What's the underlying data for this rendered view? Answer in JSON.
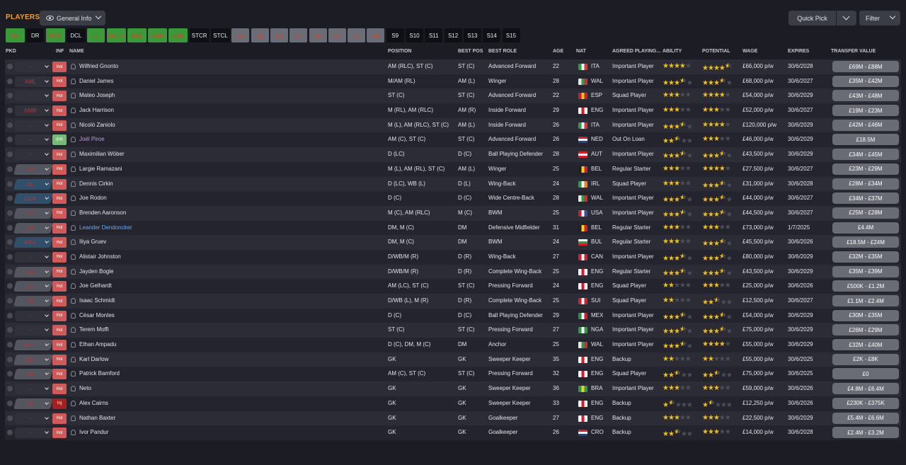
{
  "header": {
    "title": "PLAYERS",
    "view": "General Info",
    "quick_pick": "Quick Pick",
    "filter": "Filter"
  },
  "positions": [
    {
      "label": "GK",
      "state": "green"
    },
    {
      "label": "DR",
      "state": "off"
    },
    {
      "label": "DCR",
      "state": "green"
    },
    {
      "label": "DCL",
      "state": "off"
    },
    {
      "label": "DL",
      "state": "green"
    },
    {
      "label": "DMCR",
      "state": "green"
    },
    {
      "label": "MCL",
      "state": "green"
    },
    {
      "label": "AMR",
      "state": "green"
    },
    {
      "label": "AML",
      "state": "green"
    },
    {
      "label": "STCR",
      "state": "off"
    },
    {
      "label": "STCL",
      "state": "off"
    },
    {
      "label": "S1",
      "state": "gray"
    },
    {
      "label": "S2",
      "state": "gray"
    },
    {
      "label": "S3",
      "state": "gray"
    },
    {
      "label": "S4",
      "state": "gray"
    },
    {
      "label": "S5",
      "state": "gray"
    },
    {
      "label": "S6",
      "state": "gray"
    },
    {
      "label": "S7",
      "state": "gray"
    },
    {
      "label": "S8",
      "state": "gray"
    },
    {
      "label": "S9",
      "state": "off"
    },
    {
      "label": "S10",
      "state": "off"
    },
    {
      "label": "S11",
      "state": "off"
    },
    {
      "label": "S12",
      "state": "off"
    },
    {
      "label": "S13",
      "state": "off"
    },
    {
      "label": "S14",
      "state": "off"
    },
    {
      "label": "S15",
      "state": "off"
    }
  ],
  "columns": {
    "pkd": "PKD",
    "inf": "INF",
    "name": "NAME",
    "position": "POSITION",
    "best_pos": "BEST POS",
    "best_role": "BEST ROLE",
    "age": "AGE",
    "nat": "NAT",
    "agreed": "AGREED PLAYING...",
    "ability": "ABILITY",
    "potential": "POTENTIAL",
    "wage": "WAGE",
    "expires": "EXPIRES",
    "transfer_value": "TRANSFER VALUE"
  },
  "colors": {
    "ITA": [
      "#2e9a48",
      "#f2f2f2",
      "#d23a3a"
    ],
    "WAL": [
      "#e8e8e8",
      "#2e9a48",
      "#c83030"
    ],
    "ESP": [
      "#c8202a",
      "#f2c020",
      "#c8202a"
    ],
    "ENG": [
      "#f4f4f4",
      "#d02030",
      "#f4f4f4"
    ],
    "NED": [
      "#c02030",
      "#f4f4f4",
      "#25408f"
    ],
    "AUT": [
      "#d02030",
      "#f4f4f4",
      "#d02030"
    ],
    "BEL": [
      "#202020",
      "#f2d020",
      "#d02030"
    ],
    "IRL": [
      "#2e9a48",
      "#f4f4f4",
      "#f08030"
    ],
    "USA": [
      "#c02030",
      "#f4f4f4",
      "#3c4a9a"
    ],
    "BUL": [
      "#f4f4f4",
      "#2e9a48",
      "#d02030"
    ],
    "CAN": [
      "#d02030",
      "#f4f4f4",
      "#d02030"
    ],
    "SUI": [
      "#d02030",
      "#f4f4f4",
      "#d02030"
    ],
    "MEX": [
      "#2e8a48",
      "#f4f4f4",
      "#c02030"
    ],
    "NGA": [
      "#2e9a48",
      "#f4f4f4",
      "#2e9a48"
    ],
    "BRA": [
      "#2e9a48",
      "#f2d020",
      "#2e9a48"
    ],
    "CRO": [
      "#d02030",
      "#f4f4f4",
      "#25408f"
    ]
  },
  "players": [
    {
      "pkd": "-",
      "pkd_style": "dark",
      "inf": "Hol",
      "name": "Wilfried Gnonto",
      "name_style": "",
      "position": "AM (RLC), ST (C)",
      "best_pos": "ST (C)",
      "best_role": "Advanced Forward",
      "age": "22",
      "nat": "ITA",
      "agreed": "Important Player",
      "ability": 4,
      "potential": 4.5,
      "wage": "£66,000 p/w",
      "expires": "30/6/2028",
      "tv": "£69M - £88M"
    },
    {
      "pkd": "AML",
      "pkd_style": "dark",
      "inf": "Hol",
      "name": "Daniel James",
      "name_style": "",
      "position": "M/AM (RL)",
      "best_pos": "AM (L)",
      "best_role": "Winger",
      "age": "28",
      "nat": "WAL",
      "agreed": "Important Player",
      "ability": 3.5,
      "potential": 3.5,
      "wage": "£68,000 p/w",
      "expires": "30/6/2027",
      "tv": "£35M - £42M"
    },
    {
      "pkd": "-",
      "pkd_style": "dark",
      "inf": "Hol",
      "name": "Mateo Joseph",
      "name_style": "",
      "position": "ST (C)",
      "best_pos": "ST (C)",
      "best_role": "Advanced Forward",
      "age": "22",
      "nat": "ESP",
      "agreed": "Squad Player",
      "ability": 3,
      "potential": 4,
      "wage": "£54,000 p/w",
      "expires": "30/6/2029",
      "tv": "£43M - £48M"
    },
    {
      "pkd": "AMR",
      "pkd_style": "dark",
      "inf": "Hol",
      "name": "Jack Harrison",
      "name_style": "",
      "position": "M (RL), AM (RLC)",
      "best_pos": "AM (R)",
      "best_role": "Inside Forward",
      "age": "29",
      "nat": "ENG",
      "agreed": "Important Player",
      "ability": 3,
      "potential": 3,
      "wage": "£52,000 p/w",
      "expires": "30/6/2027",
      "tv": "£19M - £23M"
    },
    {
      "pkd": "-",
      "pkd_style": "dark",
      "inf": "Hol",
      "name": "Nicolò Zaniolo",
      "name_style": "",
      "position": "M (L), AM (RLC), ST (C)",
      "best_pos": "AM (L)",
      "best_role": "Inside Forward",
      "age": "26",
      "nat": "ITA",
      "agreed": "Important Player",
      "ability": 3.5,
      "potential": 4,
      "wage": "£120,000 p/w",
      "expires": "30/6/2029",
      "tv": "£42M - £46M"
    },
    {
      "pkd": "-",
      "pkd_style": "dark",
      "inf": "IPR",
      "name": "Joël Piroe",
      "name_style": "purple",
      "position": "AM (C), ST (C)",
      "best_pos": "ST (C)",
      "best_role": "Advanced Forward",
      "age": "26",
      "nat": "NED",
      "agreed": "Out On Loan",
      "ability": 2.5,
      "potential": 3,
      "wage": "£46,000 p/w",
      "expires": "30/6/2029",
      "tv": "£18.5M"
    },
    {
      "pkd": "-",
      "pkd_style": "dark",
      "inf": "Hol",
      "name": "Maximilian Wöber",
      "name_style": "",
      "position": "D (LC)",
      "best_pos": "D (C)",
      "best_role": "Ball Playing Defender",
      "age": "28",
      "nat": "AUT",
      "agreed": "Important Player",
      "ability": 3.5,
      "potential": 3.5,
      "wage": "£43,500 p/w",
      "expires": "30/6/2029",
      "tv": "£34M - £45M"
    },
    {
      "pkd": "S5",
      "pkd_style": "slant",
      "inf": "Hol",
      "name": "Largie Ramazani",
      "name_style": "",
      "position": "M (L), AM (RL), ST (C)",
      "best_pos": "AM (L)",
      "best_role": "Winger",
      "age": "25",
      "nat": "BEL",
      "agreed": "Regular Starter",
      "ability": 3,
      "potential": 4,
      "wage": "£27,500 p/w",
      "expires": "30/6/2027",
      "tv": "£23M - £29M"
    },
    {
      "pkd": "DL",
      "pkd_style": "blue",
      "inf": "Hol",
      "name": "Dennis Cirkin",
      "name_style": "",
      "position": "D (LC), WB (L)",
      "best_pos": "D (L)",
      "best_role": "Wing-Back",
      "age": "24",
      "nat": "IRL",
      "agreed": "Squad Player",
      "ability": 3,
      "potential": 3.5,
      "wage": "£31,000 p/w",
      "expires": "30/6/2028",
      "tv": "£28M - £34M"
    },
    {
      "pkd": "DCR",
      "pkd_style": "blue",
      "inf": "Hol",
      "name": "Joe Rodon",
      "name_style": "",
      "position": "D (C)",
      "best_pos": "D (C)",
      "best_role": "Wide Centre-Back",
      "age": "28",
      "nat": "WAL",
      "agreed": "Important Player",
      "ability": 3.5,
      "potential": 3.5,
      "wage": "£44,000 p/w",
      "expires": "30/6/2027",
      "tv": "£34M - £37M"
    },
    {
      "pkd": "S2",
      "pkd_style": "slant",
      "inf": "Hol",
      "name": "Brenden Aaronson",
      "name_style": "",
      "position": "M (C), AM (RLC)",
      "best_pos": "M (C)",
      "best_role": "BWM",
      "age": "25",
      "nat": "USA",
      "agreed": "Important Player",
      "ability": 3.5,
      "potential": 3.5,
      "wage": "£44,500 p/w",
      "expires": "30/6/2027",
      "tv": "£25M - £28M"
    },
    {
      "pkd": "S4",
      "pkd_style": "slant",
      "inf": "Hol",
      "name": "Leander Dendoncker",
      "name_style": "blue",
      "position": "DM, M (C)",
      "best_pos": "DM",
      "best_role": "Defensive Midfielder",
      "age": "31",
      "nat": "BEL",
      "agreed": "Regular Starter",
      "ability": 3,
      "potential": 3,
      "wage": "£73,000 p/w",
      "expires": "1/7/2025",
      "tv": "£4.4M"
    },
    {
      "pkd": "MCL",
      "pkd_style": "blue",
      "inf": "Hol",
      "name": "Iliya Gruev",
      "name_style": "",
      "position": "DM, M (C)",
      "best_pos": "DM",
      "best_role": "BWM",
      "age": "24",
      "nat": "BUL",
      "agreed": "Regular Starter",
      "ability": 3,
      "potential": 3.5,
      "wage": "£45,500 p/w",
      "expires": "30/6/2026",
      "tv": "£18.5M - £24M"
    },
    {
      "pkd": "-",
      "pkd_style": "dark",
      "inf": "Hol",
      "name": "Alistair Johnston",
      "name_style": "",
      "position": "D/WB/M (R)",
      "best_pos": "D (R)",
      "best_role": "Wing-Back",
      "age": "27",
      "nat": "CAN",
      "agreed": "Important Player",
      "ability": 3.5,
      "potential": 3.5,
      "wage": "£80,000 p/w",
      "expires": "30/6/2029",
      "tv": "£32M - £35M"
    },
    {
      "pkd": "S3",
      "pkd_style": "slant",
      "inf": "Hol",
      "name": "Jayden Bogle",
      "name_style": "",
      "position": "D/WB/M (R)",
      "best_pos": "D (R)",
      "best_role": "Complete Wing-Back",
      "age": "25",
      "nat": "ENG",
      "agreed": "Regular Starter",
      "ability": 3.5,
      "potential": 3.5,
      "wage": "£43,500 p/w",
      "expires": "30/6/2029",
      "tv": "£35M - £39M"
    },
    {
      "pkd": "S7",
      "pkd_style": "slant",
      "inf": "Hol",
      "name": "Joe Gelhardt",
      "name_style": "",
      "position": "AM (LC), ST (C)",
      "best_pos": "ST (C)",
      "best_role": "Pressing Forward",
      "age": "24",
      "nat": "ENG",
      "agreed": "Squad Player",
      "ability": 2,
      "potential": 3,
      "wage": "£25,000 p/w",
      "expires": "30/6/2026",
      "tv": "£500K - £1.2M"
    },
    {
      "pkd": "S8",
      "pkd_style": "slant",
      "inf": "Hol",
      "name": "Isaac Schmidt",
      "name_style": "",
      "position": "D/WB (L), M (R)",
      "best_pos": "D (R)",
      "best_role": "Complete Wing-Back",
      "age": "25",
      "nat": "SUI",
      "agreed": "Squad Player",
      "ability": 2,
      "potential": 2.5,
      "wage": "£12,500 p/w",
      "expires": "30/6/2027",
      "tv": "£1.1M - £2.4M"
    },
    {
      "pkd": "-",
      "pkd_style": "dark",
      "inf": "Hol",
      "name": "César Montes",
      "name_style": "",
      "position": "D (C)",
      "best_pos": "D (C)",
      "best_role": "Ball Playing Defender",
      "age": "29",
      "nat": "MEX",
      "agreed": "Important Player",
      "ability": 3.5,
      "potential": 3.5,
      "wage": "£54,000 p/w",
      "expires": "30/6/2029",
      "tv": "£30M - £35M"
    },
    {
      "pkd": "-",
      "pkd_style": "dark",
      "inf": "Hol",
      "name": "Terem Moffi",
      "name_style": "",
      "position": "ST (C)",
      "best_pos": "ST (C)",
      "best_role": "Pressing Forward",
      "age": "27",
      "nat": "NGA",
      "agreed": "Important Player",
      "ability": 3.5,
      "potential": 3.5,
      "wage": "£75,000 p/w",
      "expires": "30/6/2029",
      "tv": "£26M - £29M"
    },
    {
      "pkd": "DM...",
      "pkd_style": "slant",
      "inf": "Hol",
      "name": "Ethan Ampadu",
      "name_style": "",
      "position": "D (C), DM, M (C)",
      "best_pos": "DM",
      "best_role": "Anchor",
      "age": "25",
      "nat": "WAL",
      "agreed": "Important Player",
      "ability": 3.5,
      "potential": 4,
      "wage": "£55,000 p/w",
      "expires": "30/6/2029",
      "tv": "£32M - £40M"
    },
    {
      "pkd": "GK",
      "pkd_style": "slant",
      "inf": "Hol",
      "name": "Karl Darlow",
      "name_style": "",
      "position": "GK",
      "best_pos": "GK",
      "best_role": "Sweeper Keeper",
      "age": "35",
      "nat": "ENG",
      "agreed": "Backup",
      "ability": 2,
      "potential": 2,
      "wage": "£55,000 p/w",
      "expires": "30/6/2025",
      "tv": "£2K - £8K"
    },
    {
      "pkd": "S6",
      "pkd_style": "slant",
      "inf": "Hol",
      "name": "Patrick Bamford",
      "name_style": "",
      "position": "AM (C), ST (C)",
      "best_pos": "ST (C)",
      "best_role": "Pressing Forward",
      "age": "32",
      "nat": "ENG",
      "agreed": "Squad Player",
      "ability": 2.5,
      "potential": 2.5,
      "wage": "£75,000 p/w",
      "expires": "30/6/2025",
      "tv": "£0"
    },
    {
      "pkd": "-",
      "pkd_style": "dark",
      "inf": "Hol",
      "name": "Neto",
      "name_style": "",
      "position": "GK",
      "best_pos": "GK",
      "best_role": "Sweeper Keeper",
      "age": "36",
      "nat": "BRA",
      "agreed": "Important Player",
      "ability": 3,
      "potential": 3,
      "wage": "£59,000 p/w",
      "expires": "30/6/2026",
      "tv": "£4.8M - £6.4M"
    },
    {
      "pkd": "S1",
      "pkd_style": "slant",
      "inf": "Inj",
      "name": "Alex Cairns",
      "name_style": "",
      "position": "GK",
      "best_pos": "GK",
      "best_role": "Sweeper Keeper",
      "age": "33",
      "nat": "ENG",
      "agreed": "Backup",
      "ability": 1.5,
      "potential": 1.5,
      "wage": "£12,250 p/w",
      "expires": "30/6/2026",
      "tv": "£230K - £375K"
    },
    {
      "pkd": "-",
      "pkd_style": "dark",
      "inf": "Hol",
      "name": "Nathan Baxter",
      "name_style": "",
      "position": "GK",
      "best_pos": "GK",
      "best_role": "Goalkeeper",
      "age": "27",
      "nat": "ENG",
      "agreed": "Backup",
      "ability": 3,
      "potential": 3,
      "wage": "£22,500 p/w",
      "expires": "30/6/2029",
      "tv": "£5.4M - £6.6M"
    },
    {
      "pkd": "-",
      "pkd_style": "dark",
      "inf": "Hol",
      "name": "Ivor Pandur",
      "name_style": "",
      "position": "GK",
      "best_pos": "GK",
      "best_role": "Goalkeeper",
      "age": "26",
      "nat": "CRO",
      "agreed": "Backup",
      "ability": 2.5,
      "potential": 3,
      "wage": "£14,000 p/w",
      "expires": "30/6/2028",
      "tv": "£2.4M - £3.2M"
    }
  ]
}
